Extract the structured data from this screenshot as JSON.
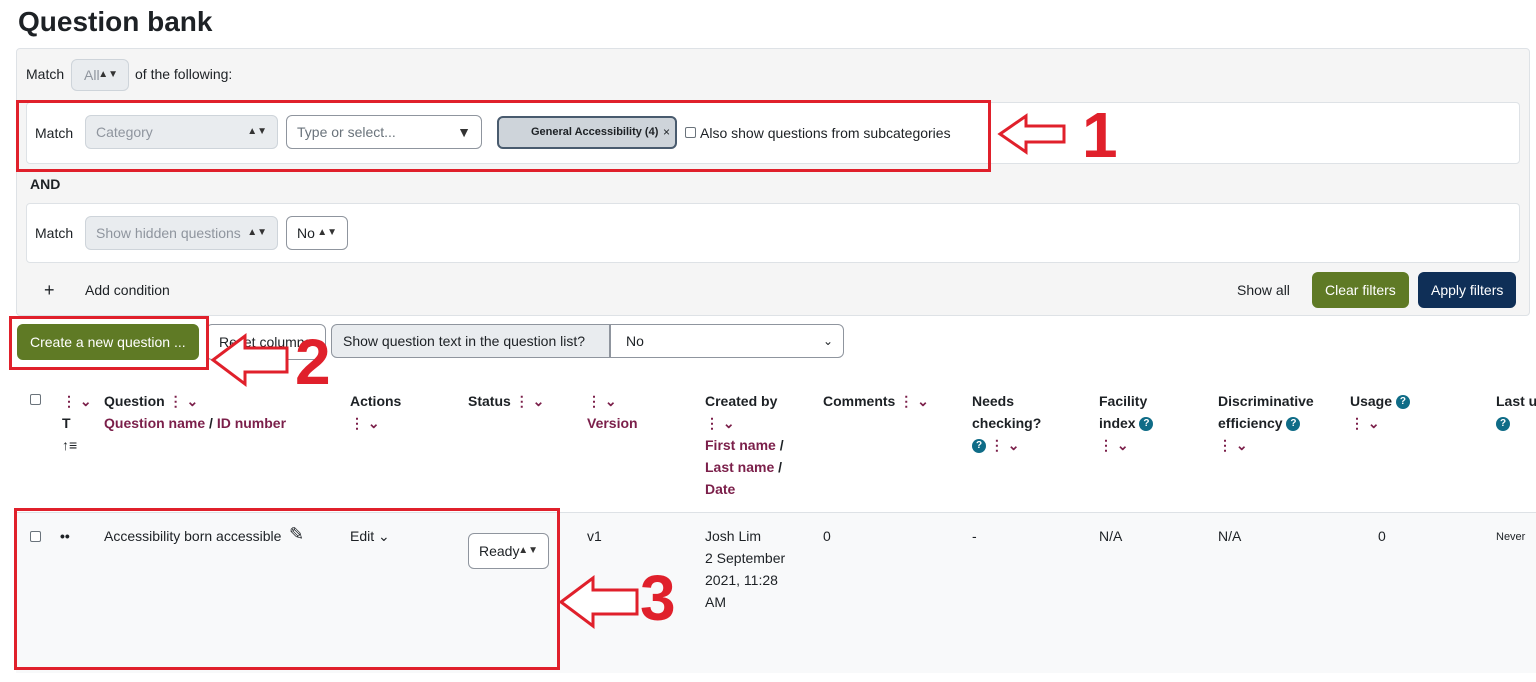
{
  "page": {
    "title": "Question bank"
  },
  "filters": {
    "match_label": "Match",
    "match_all_value": "All",
    "of_following": "of the following:",
    "row1": {
      "match_label": "Match",
      "field": "Category",
      "type_placeholder": "Type or select...",
      "chip": "General Accessibility (4)",
      "chip_remove": "×",
      "subcat_label": "Also show questions from subcategories"
    },
    "and_label": "AND",
    "row2": {
      "match_label": "Match",
      "field": "Show hidden questions",
      "value": "No"
    },
    "add_symbol": "+",
    "add_condition": "Add condition",
    "show_all": "Show all",
    "clear_filters": "Clear filters",
    "apply_filters": "Apply filters"
  },
  "toolbar": {
    "create_button": "Create a new question ...",
    "reset_columns": "Reset columns",
    "show_text_label": "Show question text in the question list?",
    "show_text_value": "No"
  },
  "annotations": {
    "n1": "1",
    "n2": "2",
    "n3": "3"
  },
  "table": {
    "headers": {
      "t": "T",
      "question": "Question",
      "question_name": "Question name",
      "slash": " / ",
      "id_number": "ID number",
      "actions": "Actions",
      "status": "Status",
      "version": "Version",
      "created_by": "Created by",
      "first_name": "First name",
      "last_name": "Last name",
      "date": "Date",
      "comments": "Comments",
      "needs": "Needs",
      "checking": "checking?",
      "facility": "Facility",
      "index": "index",
      "discriminative": "Discriminative",
      "efficiency": "efficiency",
      "usage": "Usage",
      "last_used": "Last u"
    },
    "row": {
      "type_icon": "••",
      "name": "Accessibility born accessible",
      "edit": "Edit",
      "status": "Ready",
      "version": "v1",
      "created_name": "Josh Lim",
      "created_line2": "2 September",
      "created_line3": "2021, 11:28",
      "created_line4": "AM",
      "comments": "0",
      "needs_checking": "-",
      "facility": "N/A",
      "discriminative": "N/A",
      "usage": "0",
      "last_used": "Never"
    }
  },
  "colors": {
    "accent_red": "#e0202b",
    "green": "#5f7a25",
    "navy": "#0f2f57",
    "link": "#7b1f4a"
  }
}
